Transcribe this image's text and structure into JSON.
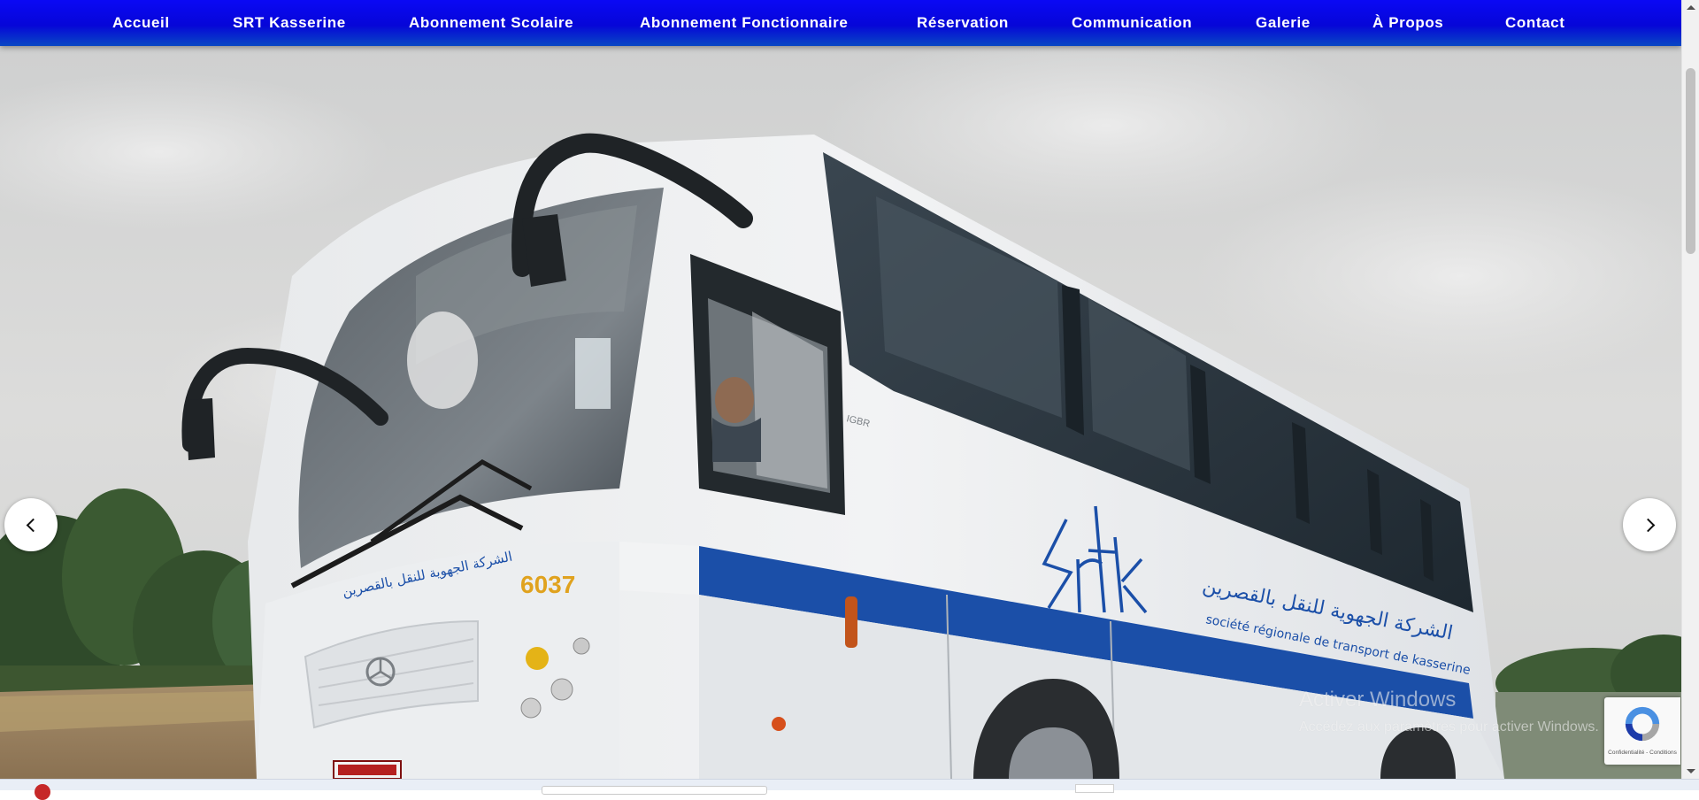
{
  "nav": {
    "items": [
      {
        "label": "Accueil"
      },
      {
        "label": "SRT Kasserine"
      },
      {
        "label": "Abonnement Scolaire"
      },
      {
        "label": "Abonnement Fonctionnaire"
      },
      {
        "label": "Réservation"
      },
      {
        "label": "Communication"
      },
      {
        "label": "Galerie"
      },
      {
        "label": "À Propos"
      },
      {
        "label": "Contact"
      }
    ]
  },
  "hero": {
    "bus": {
      "fleet_number": "6037",
      "brand_logo": "srtk",
      "arabic_name": "الشركة الجهوية للنقل بالقصرين",
      "french_name": "société régionale de transport de kasserine",
      "model_badge": "IGBR"
    },
    "controls": {
      "prev_icon": "chevron-left-icon",
      "next_icon": "chevron-right-icon"
    }
  },
  "watermark": {
    "title": "Activer Windows",
    "subtitle": "Accédez aux paramètres pour activer Windows."
  },
  "recaptcha": {
    "links": "Confidentialité - Conditions"
  },
  "colors": {
    "nav_blue": "#0606d8",
    "bus_stripe": "#1b4fa8",
    "fleet_number": "#e0a21e"
  }
}
